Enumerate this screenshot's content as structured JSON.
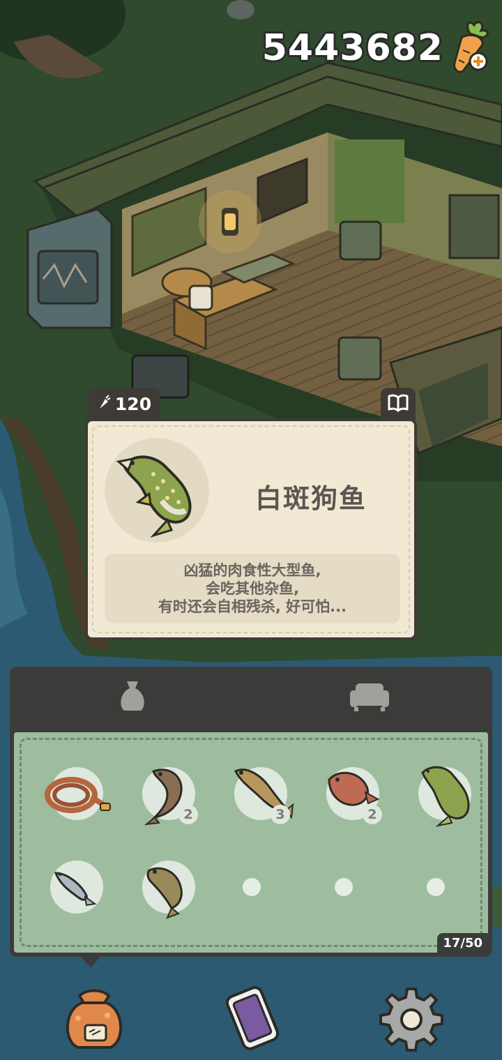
{
  "currency": {
    "amount": "5443682",
    "icon": "carrot-plus-icon"
  },
  "item_card": {
    "price": "120",
    "price_icon": "carrot-icon",
    "book_icon": "book-icon",
    "name": "白斑狗鱼",
    "description": [
      "凶猛的肉食性大型鱼,",
      "会吃其他杂鱼,",
      "有时还会自相残杀, 好可怕..."
    ]
  },
  "inventory": {
    "tabs": [
      {
        "name": "bag",
        "icon": "sack-icon"
      },
      {
        "name": "furniture",
        "icon": "sofa-icon"
      }
    ],
    "slots": [
      {
        "item": "rope-coil",
        "count": ""
      },
      {
        "item": "catfish",
        "count": "2"
      },
      {
        "item": "cod",
        "count": "3"
      },
      {
        "item": "red-fish",
        "count": "2"
      },
      {
        "item": "pike",
        "count": ""
      },
      {
        "item": "small-fish",
        "count": ""
      },
      {
        "item": "goby",
        "count": ""
      },
      {
        "item": "empty",
        "count": ""
      },
      {
        "item": "empty",
        "count": ""
      },
      {
        "item": "empty",
        "count": ""
      }
    ],
    "capacity": "17/50"
  },
  "nav": [
    {
      "name": "bag",
      "icon": "carrot-bag-icon"
    },
    {
      "name": "phone",
      "icon": "phone-icon"
    },
    {
      "name": "settings",
      "icon": "gear-icon"
    }
  ],
  "colors": {
    "panel_dark": "#3b3b3a",
    "card_bg": "#f1e9d4",
    "inventory_green": "#9ebd9e",
    "grass": "#2f4a2c",
    "water": "#2d5a73"
  }
}
